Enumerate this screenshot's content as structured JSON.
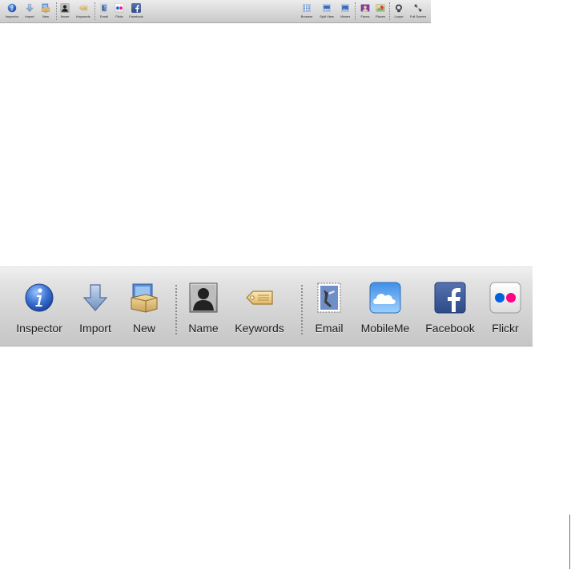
{
  "small_toolbar": {
    "left_items": [
      {
        "label": "Inspector",
        "icon": "info-icon"
      },
      {
        "label": "Import",
        "icon": "import-arrow-icon"
      },
      {
        "label": "New",
        "icon": "new-box-icon"
      },
      {
        "label": "Name",
        "icon": "person-silhouette-icon"
      },
      {
        "label": "Keywords",
        "icon": "keyword-tag-icon"
      },
      {
        "label": "Email",
        "icon": "email-stamp-icon"
      },
      {
        "label": "Flickr",
        "icon": "flickr-icon"
      },
      {
        "label": "Facebook",
        "icon": "facebook-icon"
      }
    ],
    "right_items": [
      {
        "label": "Browser",
        "icon": "browser-grid-icon"
      },
      {
        "label": "Split View",
        "icon": "split-view-icon"
      },
      {
        "label": "Viewer",
        "icon": "viewer-icon"
      },
      {
        "label": "Faces",
        "icon": "faces-icon"
      },
      {
        "label": "Places",
        "icon": "places-icon"
      },
      {
        "label": "Loupe",
        "icon": "loupe-icon"
      },
      {
        "label": "Full Screen",
        "icon": "full-screen-icon"
      }
    ]
  },
  "large_toolbar": {
    "items": [
      {
        "label": "Inspector",
        "icon": "info-icon"
      },
      {
        "label": "Import",
        "icon": "import-arrow-icon"
      },
      {
        "label": "New",
        "icon": "new-box-icon"
      },
      {
        "label": "Name",
        "icon": "person-silhouette-icon"
      },
      {
        "label": "Keywords",
        "icon": "keyword-tag-icon"
      },
      {
        "label": "Email",
        "icon": "email-stamp-icon"
      },
      {
        "label": "MobileMe",
        "icon": "mobileme-cloud-icon"
      },
      {
        "label": "Facebook",
        "icon": "facebook-icon"
      },
      {
        "label": "Flickr",
        "icon": "flickr-icon"
      }
    ]
  },
  "colors": {
    "info_blue": "#3a6fd0",
    "facebook_blue": "#3b5998",
    "flickr_blue": "#0063dc",
    "flickr_pink": "#ff0084",
    "mobileme_sky": "#4a9be8"
  }
}
